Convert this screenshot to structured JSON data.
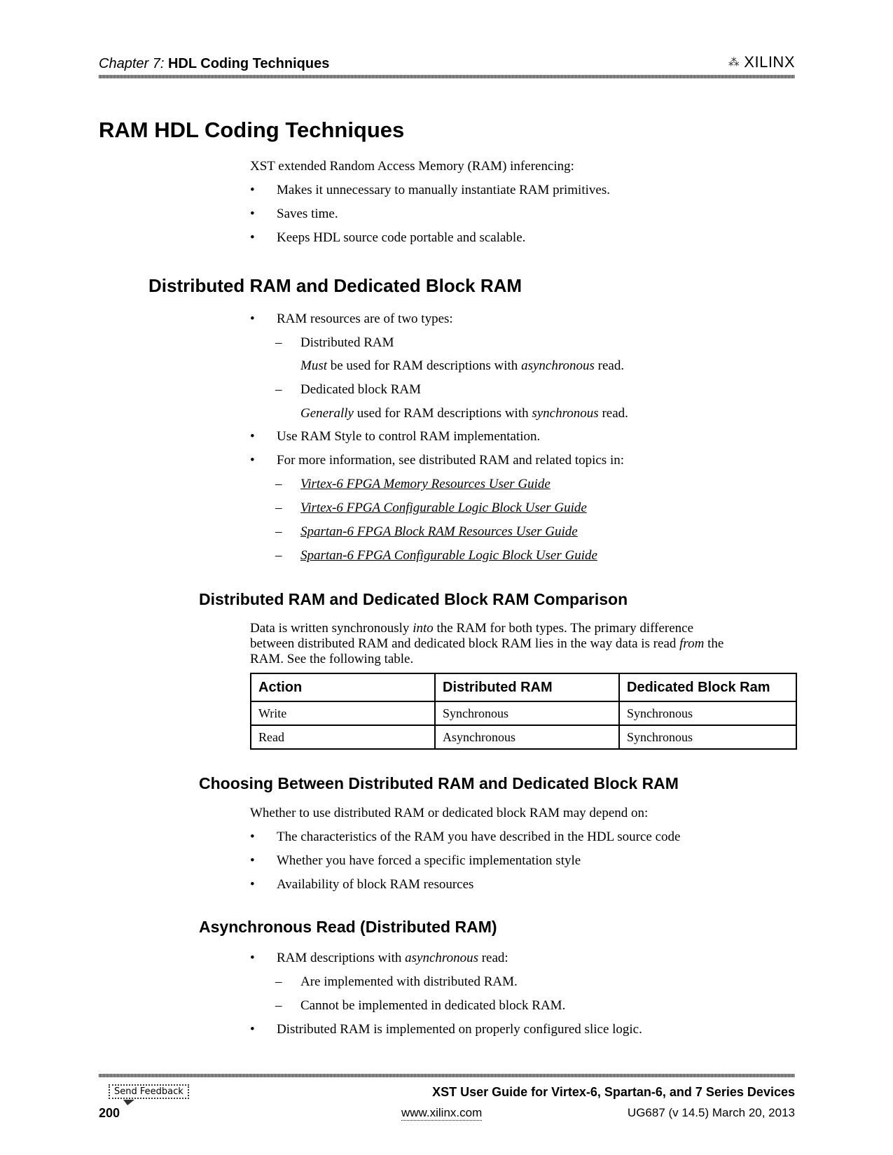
{
  "header": {
    "chapter_label": "Chapter 7:",
    "chapter_title": "HDL Coding Techniques",
    "logo_text": "XILINX"
  },
  "title": "RAM HDL Coding Techniques",
  "intro": {
    "lead": "XST extended Random Access Memory (RAM) inferencing:",
    "bullets": [
      "Makes it unnecessary to manually instantiate RAM primitives.",
      "Saves time.",
      "Keeps HDL source code portable and scalable."
    ]
  },
  "section1": {
    "heading": "Distributed RAM and Dedicated Block RAM",
    "b1": "RAM resources are of two types:",
    "d1": "Distributed RAM",
    "d1_em": "Must",
    "d1_mid": " be used for RAM descriptions with ",
    "d1_em2": "asynchronous",
    "d1_end": " read.",
    "d2": "Dedicated block RAM",
    "d2_em": "Generally",
    "d2_mid": " used for RAM descriptions with ",
    "d2_em2": "synchronous",
    "d2_end": " read.",
    "b2": "Use RAM Style to control RAM implementation.",
    "b3": "For more information, see distributed RAM and related topics in:",
    "links": [
      "Virtex-6 FPGA Memory Resources User Guide",
      "Virtex-6 FPGA Configurable Logic Block User Guide",
      "Spartan-6 FPGA Block RAM Resources User Guide",
      "Spartan-6 FPGA Configurable Logic Block User Guide"
    ]
  },
  "section2": {
    "heading": "Distributed RAM and Dedicated Block RAM Comparison",
    "p1a": "Data is written synchronously ",
    "p1_em": "into",
    "p1b": " the RAM for both types.  The primary difference",
    "p2a": "between distributed RAM and dedicated block RAM lies in the way data is read ",
    "p2_em": "from",
    "p2b": " the",
    "p3": "RAM. See the following table.",
    "table": {
      "headers": [
        "Action",
        "Distributed RAM",
        "Dedicated Block Ram"
      ],
      "rows": [
        [
          "Write",
          "Synchronous",
          "Synchronous"
        ],
        [
          "Read",
          "Asynchronous",
          "Synchronous"
        ]
      ]
    }
  },
  "section3": {
    "heading": "Choosing Between Distributed RAM and Dedicated Block RAM",
    "lead": "Whether to use distributed RAM or dedicated block RAM may depend on:",
    "bullets": [
      "The characteristics of the RAM you have described in the HDL source code",
      "Whether you have forced a specific implementation style",
      "Availability of block RAM resources"
    ]
  },
  "section4": {
    "heading": "Asynchronous Read (Distributed RAM)",
    "b1a": "RAM descriptions with ",
    "b1_em": "asynchronous",
    "b1b": " read:",
    "dashes": [
      "Are implemented with distributed RAM.",
      "Cannot be implemented in dedicated block RAM."
    ],
    "b2": "Distributed RAM is implemented on properly configured slice logic."
  },
  "footer": {
    "feedback": "Send Feedback",
    "page_number": "200",
    "doc_title": "XST User Guide for Virtex-6, Spartan-6, and 7 Series Devices",
    "url": "www.xilinx.com",
    "doc_id": "UG687 (v 14.5) March 20, 2013"
  }
}
